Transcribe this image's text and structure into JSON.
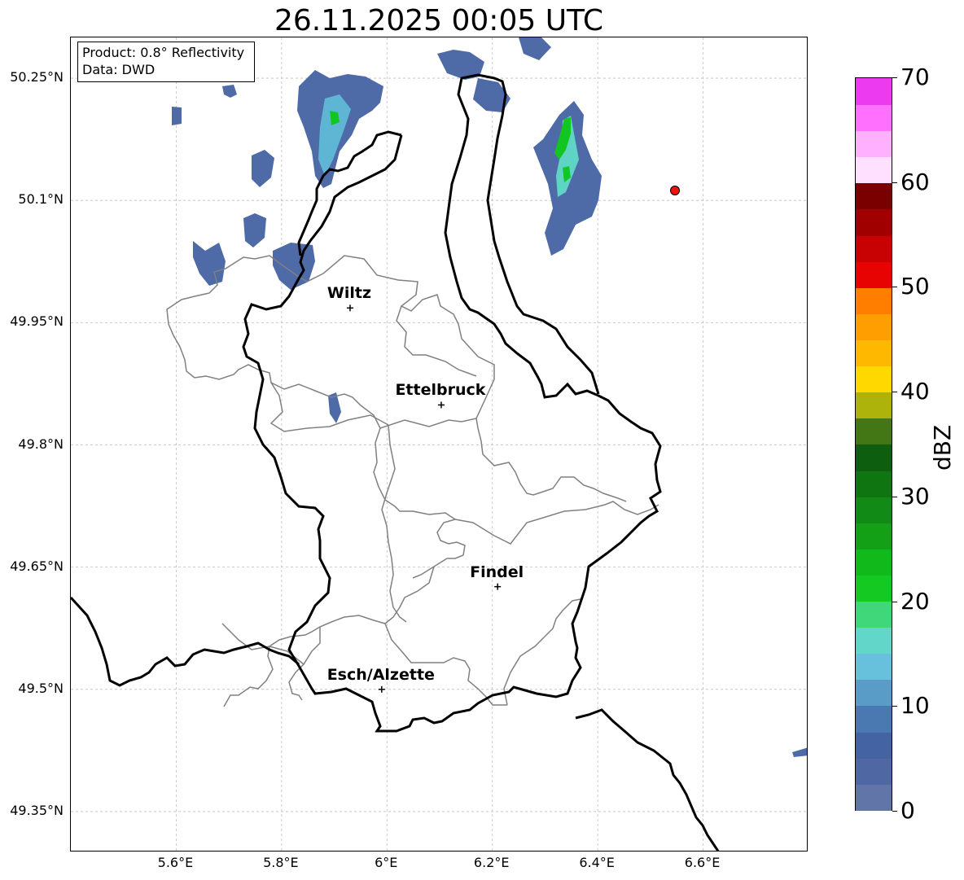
{
  "title": "26.11.2025 00:05 UTC",
  "info_box": {
    "product": "Product: 0.8° Reflectivity",
    "data_source": "Data: DWD"
  },
  "map": {
    "lon_range": [
      5.4,
      6.8
    ],
    "lat_range": [
      49.3,
      50.3
    ],
    "lat_ticks": [
      {
        "value": 50.25,
        "label": "50.25°N"
      },
      {
        "value": 50.1,
        "label": "50.1°N"
      },
      {
        "value": 49.95,
        "label": "49.95°N"
      },
      {
        "value": 49.8,
        "label": "49.8°N"
      },
      {
        "value": 49.65,
        "label": "49.65°N"
      },
      {
        "value": 49.5,
        "label": "49.5°N"
      },
      {
        "value": 49.35,
        "label": "49.35°N"
      }
    ],
    "lon_ticks": [
      {
        "value": 5.6,
        "label": "5.6°E"
      },
      {
        "value": 5.8,
        "label": "5.8°E"
      },
      {
        "value": 6.0,
        "label": "6°E"
      },
      {
        "value": 6.2,
        "label": "6.2°E"
      },
      {
        "value": 6.4,
        "label": "6.4°E"
      },
      {
        "value": 6.6,
        "label": "6.6°E"
      }
    ],
    "cities": [
      {
        "name": "Wiltz",
        "lon": 5.93,
        "lat": 49.968
      },
      {
        "name": "Ettelbruck",
        "lon": 6.103,
        "lat": 49.849
      },
      {
        "name": "Findel",
        "lon": 6.21,
        "lat": 49.626
      },
      {
        "name": "Esch/Alzette",
        "lon": 5.99,
        "lat": 49.5
      }
    ],
    "radar_site": {
      "lon": 6.548,
      "lat": 50.111,
      "color": "#e8140c"
    },
    "echo_colors": {
      "weak": "#4e6aa7",
      "light": "#4a7ab3",
      "moderate": "#5eb6d4",
      "cyan": "#5fd4c4",
      "green": "#12c622"
    }
  },
  "colorbar": {
    "label": "dBZ",
    "min": 0,
    "max": 70,
    "ticks": [
      {
        "value": 0,
        "label": "0"
      },
      {
        "value": 10,
        "label": "10"
      },
      {
        "value": 20,
        "label": "20"
      },
      {
        "value": 30,
        "label": "30"
      },
      {
        "value": 40,
        "label": "40"
      },
      {
        "value": 50,
        "label": "50"
      },
      {
        "value": 60,
        "label": "60"
      },
      {
        "value": 70,
        "label": "70"
      }
    ],
    "colors": [
      "#6275a8",
      "#4f68a4",
      "#4363a3",
      "#4a79b2",
      "#5a9cc8",
      "#67c1dc",
      "#62d6c8",
      "#3fd77a",
      "#14c922",
      "#12b91a",
      "#13a016",
      "#118b15",
      "#0e7511",
      "#0d5e0e",
      "#437716",
      "#adb30b",
      "#ffd800",
      "#ffb800",
      "#ff9e00",
      "#ff7e00",
      "#e80303",
      "#c80202",
      "#a00000",
      "#7a0000",
      "#ffe1ff",
      "#ffb0ff",
      "#ff70ff",
      "#eb3af0"
    ]
  }
}
